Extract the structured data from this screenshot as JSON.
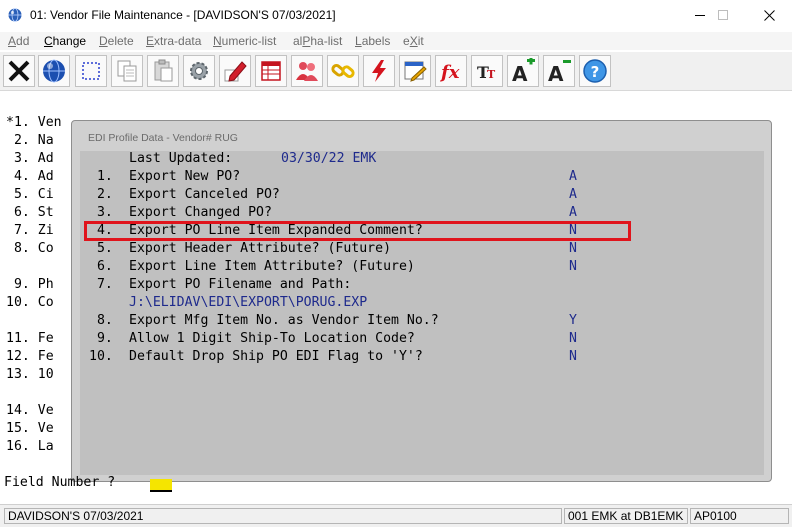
{
  "window": {
    "title": "01: Vendor File Maintenance - [DAVIDSON'S 07/03/2021]",
    "minimize_glyph": "—",
    "maximize_glyph": "☐",
    "close_glyph": "✕"
  },
  "menu": {
    "items": [
      "Add",
      "Change",
      "Delete",
      "Extra-data",
      "Numeric-list",
      "alPha-list",
      "Labels",
      "eXit"
    ],
    "active": "Change"
  },
  "toolbar": {
    "buttons": [
      "close-x-icon",
      "globe-icon",
      "select-rect-icon",
      "copy-icon",
      "paste-icon",
      "gear-icon",
      "edit-pencil-icon",
      "spreadsheet-icon",
      "users-icon",
      "link-icon",
      "lightning-icon",
      "calendar-edit-icon",
      "function-fx-icon",
      "text-size-icon",
      "font-increase-icon",
      "font-decrease-icon",
      "help-icon"
    ]
  },
  "background_form": {
    "lines": [
      "*1. Ven",
      " 2. Na",
      " 3. Ad",
      " 4. Ad",
      " 5. Ci",
      " 6. St",
      " 7. Zi",
      " 8. Co",
      "",
      " 9. Ph",
      "10. Co",
      "",
      "11. Fe",
      "12. Fe",
      "13. 10",
      "",
      "14. Ve",
      "15. Ve",
      "16. La"
    ],
    "prompt_label": "Field Number ?"
  },
  "dialog": {
    "title": "EDI Profile Data - Vendor# RUG",
    "last_updated_label": "Last Updated:",
    "last_updated_value": "03/30/22 EMK",
    "rows": [
      {
        "num": " 1.",
        "label": "Export New PO?",
        "value": "A"
      },
      {
        "num": " 2.",
        "label": "Export Canceled PO?",
        "value": "A"
      },
      {
        "num": " 3.",
        "label": "Export Changed PO?",
        "value": "A"
      },
      {
        "num": " 4.",
        "label": "Export PO Line Item Expanded Comment?",
        "value": "N"
      },
      {
        "num": " 5.",
        "label": "Export Header Attribute? (Future)",
        "value": "N"
      },
      {
        "num": " 6.",
        "label": "Export Line Item Attribute? (Future)",
        "value": "N"
      },
      {
        "num": " 7.",
        "label": "Export PO Filename and Path:",
        "value": ""
      },
      {
        "num": " 8.",
        "label": "Export Mfg Item No. as Vendor Item No.?",
        "value": "Y"
      },
      {
        "num": " 9.",
        "label": "Allow 1 Digit Ship-To Location Code?",
        "value": "N"
      },
      {
        "num": "10.",
        "label": "Default Drop Ship PO EDI Flag to 'Y'?",
        "value": "N"
      }
    ],
    "path_value": "J:\\ELIDAV\\EDI\\EXPORT\\PORUG.EXP"
  },
  "status": {
    "company": "DAVIDSON'S 07/03/2021",
    "user": "001 EMK at DB1EMK",
    "program": "AP0100"
  },
  "colors": {
    "dialog_bg": "#c0c0c0",
    "value_blue": "#1e2a8c",
    "highlight_red": "#e0141c",
    "cursor_yellow": "#f5e500"
  }
}
